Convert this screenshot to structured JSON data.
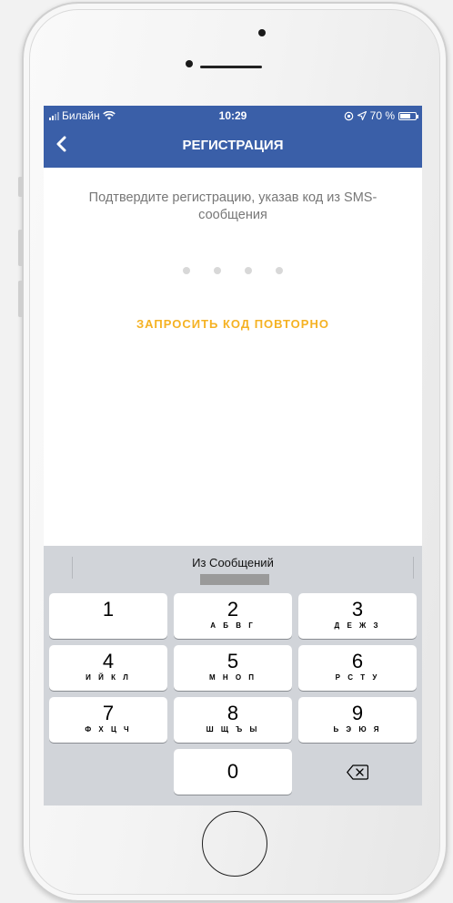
{
  "status_bar": {
    "carrier": "Билайн",
    "time": "10:29",
    "battery_text": "70 %",
    "battery_level": 0.7
  },
  "nav": {
    "title": "РЕГИСТРАЦИЯ",
    "back_icon": "chevron-left-icon"
  },
  "main": {
    "prompt": "Подтвердите регистрацию, указав код из SMS-сообщения",
    "code_length": 4,
    "code_value": "",
    "resend_label": "ЗАПРОСИТЬ КОД ПОВТОРНО"
  },
  "keyboard": {
    "suggestion_label": "Из Сообщений",
    "keys": [
      {
        "num": "1",
        "letters": ""
      },
      {
        "num": "2",
        "letters": "А Б В Г"
      },
      {
        "num": "3",
        "letters": "Д Е Ж З"
      },
      {
        "num": "4",
        "letters": "И Й К Л"
      },
      {
        "num": "5",
        "letters": "М Н О П"
      },
      {
        "num": "6",
        "letters": "Р С Т У"
      },
      {
        "num": "7",
        "letters": "Ф Х Ц Ч"
      },
      {
        "num": "8",
        "letters": "Ш Щ Ъ Ы"
      },
      {
        "num": "9",
        "letters": "Ь Э Ю Я"
      },
      {
        "num": "0",
        "letters": ""
      }
    ],
    "delete_icon": "backspace-icon"
  },
  "colors": {
    "header": "#3a5fa8",
    "accent": "#f5b223",
    "keyboard_bg": "#d1d4d9"
  }
}
